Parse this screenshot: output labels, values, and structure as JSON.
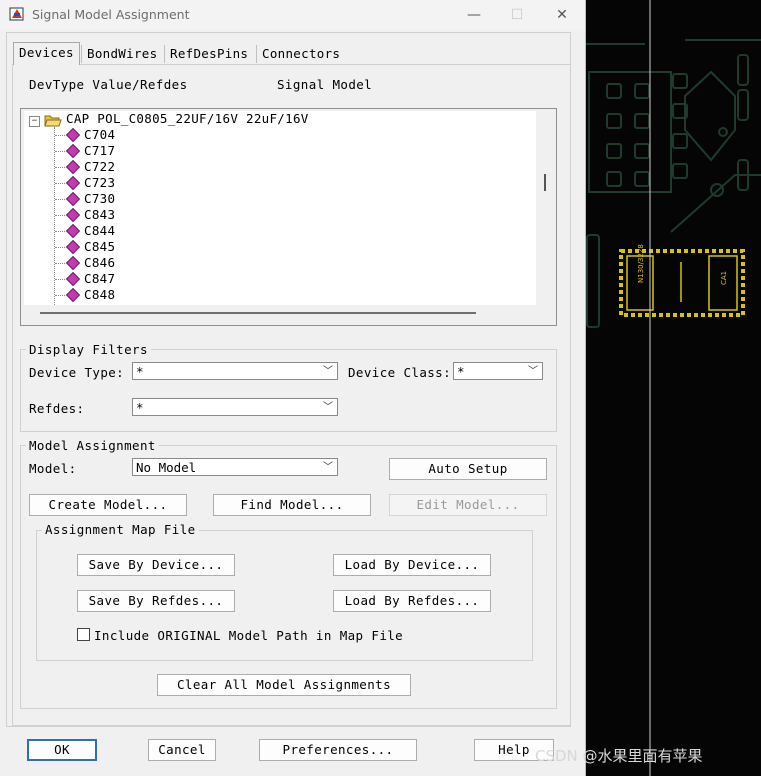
{
  "window": {
    "title": "Signal Model Assignment",
    "buttons": {
      "minimize": "—",
      "maximize": "☐",
      "close": "✕"
    }
  },
  "tabs": [
    {
      "label": "Devices"
    },
    {
      "label": "BondWires"
    },
    {
      "label": "RefDesPins"
    },
    {
      "label": "Connectors"
    }
  ],
  "headers": {
    "devtype": "DevType Value/Refdes",
    "signal_model": "Signal Model"
  },
  "tree": {
    "root": {
      "label": "CAP POL_C0805_22UF/16V 22uF/16V",
      "expander": "−"
    },
    "children": [
      "C704",
      "C717",
      "C722",
      "C723",
      "C730",
      "C843",
      "C844",
      "C845",
      "C846",
      "C847",
      "C848"
    ]
  },
  "display_filters": {
    "title": "Display Filters",
    "device_type_label": "Device Type:",
    "device_type_value": "*",
    "device_class_label": "Device Class:",
    "device_class_value": "*",
    "refdes_label": "Refdes:",
    "refdes_value": "*"
  },
  "model_assignment": {
    "title": "Model Assignment",
    "model_label": "Model:",
    "model_value": "No Model",
    "auto_setup": "Auto Setup",
    "create_model": "Create Model...",
    "find_model": "Find Model...",
    "edit_model": "Edit Model..."
  },
  "map_file": {
    "title": "Assignment Map File",
    "save_by_device": "Save By Device...",
    "load_by_device": "Load By Device...",
    "save_by_refdes": "Save By Refdes...",
    "load_by_refdes": "Load By Refdes...",
    "include_path_label": "Include ORIGINAL Model Path in Map File",
    "include_path_checked": false
  },
  "clear_all": "Clear All Model Assignments",
  "bottom": {
    "ok": "OK",
    "cancel": "Cancel",
    "preferences": "Preferences...",
    "help": "Help"
  },
  "pcb": {
    "part_label_1": "N130/3228",
    "part_label_2": "CA1"
  },
  "watermark": "CSDN @水果里面有苹果",
  "colors": {
    "pcb_background": "#050505",
    "trace": "#1e3b2c",
    "pad_outline": "#d8c400",
    "gem_icon": "#c23bb5"
  }
}
